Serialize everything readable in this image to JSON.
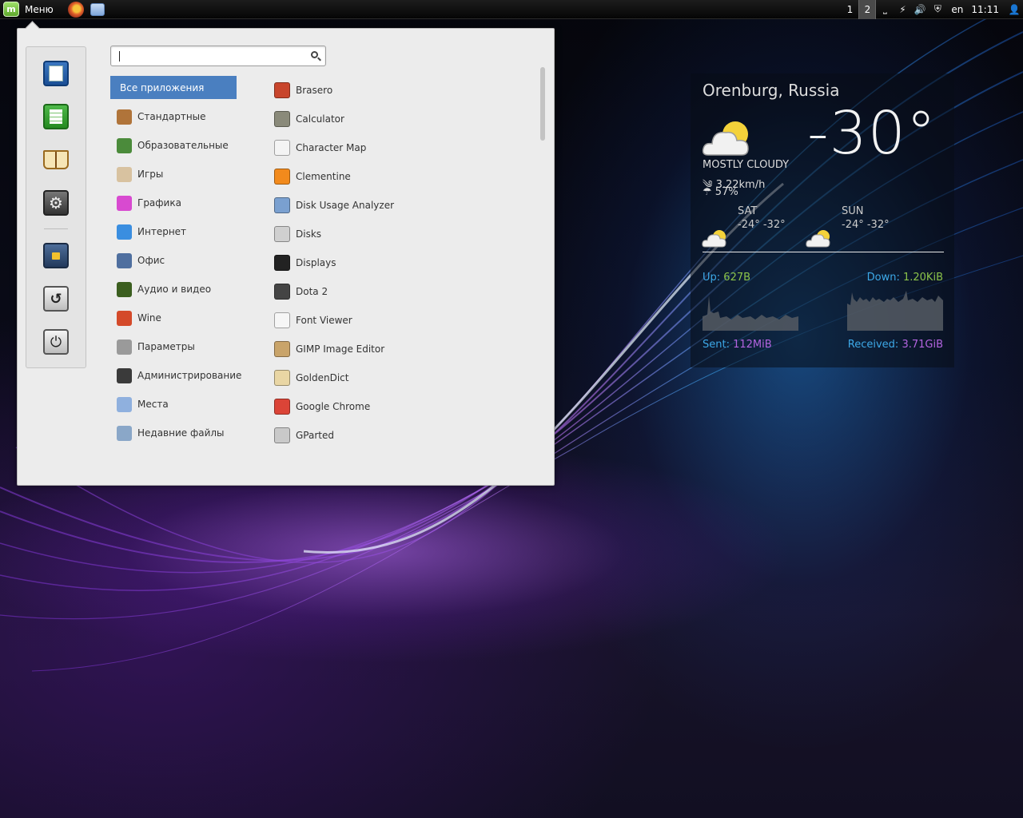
{
  "panel": {
    "menu_label": "Меню",
    "workspaces": [
      "1",
      "2"
    ],
    "active_workspace": "2",
    "keyboard_layout": "en",
    "clock": "11:11",
    "icons": [
      "firefox-icon",
      "files-icon",
      "screen-icon",
      "network-icon",
      "volume-icon",
      "shield-icon",
      "user-icon"
    ]
  },
  "menu": {
    "search": {
      "value": "",
      "placeholder": ""
    },
    "favorites": [
      "writer-icon",
      "calc-icon",
      "dictionary-icon",
      "settings-icon",
      "lock-screen-icon",
      "logout-icon",
      "power-icon"
    ],
    "categories": [
      {
        "label": "Все приложения",
        "icon": "all-apps-icon",
        "color": "#4a7fc0"
      },
      {
        "label": "Стандартные",
        "icon": "accessories-icon",
        "color": "#b0743a"
      },
      {
        "label": "Образовательные",
        "icon": "education-icon",
        "color": "#4b8b3b"
      },
      {
        "label": "Игры",
        "icon": "games-icon",
        "color": "#d8c2a0"
      },
      {
        "label": "Графика",
        "icon": "graphics-icon",
        "color": "#d84ad0"
      },
      {
        "label": "Интернет",
        "icon": "internet-icon",
        "color": "#3a8ee0"
      },
      {
        "label": "Офис",
        "icon": "office-icon",
        "color": "#4f6f9f"
      },
      {
        "label": "Аудио и видео",
        "icon": "multimedia-icon",
        "color": "#3b5e1f"
      },
      {
        "label": "Wine",
        "icon": "wine-icon",
        "color": "#d44a2a"
      },
      {
        "label": "Параметры",
        "icon": "preferences-icon",
        "color": "#9a9a9a"
      },
      {
        "label": "Администрирование",
        "icon": "administration-icon",
        "color": "#3a3a3a"
      },
      {
        "label": "Места",
        "icon": "places-icon",
        "color": "#8fb0de"
      },
      {
        "label": "Недавние файлы",
        "icon": "recent-files-icon",
        "color": "#8aa7c8"
      }
    ],
    "apps": [
      {
        "label": "Brasero",
        "icon": "brasero-icon",
        "color": "#c8452c"
      },
      {
        "label": "Calculator",
        "icon": "calculator-icon",
        "color": "#8a8a7a"
      },
      {
        "label": "Character Map",
        "icon": "character-map-icon",
        "color": "#f4f4f4"
      },
      {
        "label": "Clementine",
        "icon": "clementine-icon",
        "color": "#f28a1c"
      },
      {
        "label": "Disk Usage Analyzer",
        "icon": "disk-usage-icon",
        "color": "#7aa0d0"
      },
      {
        "label": "Disks",
        "icon": "disks-icon",
        "color": "#d0d0d0"
      },
      {
        "label": "Displays",
        "icon": "displays-icon",
        "color": "#222222"
      },
      {
        "label": "Dota 2",
        "icon": "dota2-icon",
        "color": "#444444"
      },
      {
        "label": "Font Viewer",
        "icon": "font-viewer-icon",
        "color": "#f6f6f6"
      },
      {
        "label": "GIMP Image Editor",
        "icon": "gimp-icon",
        "color": "#c9a46a"
      },
      {
        "label": "GoldenDict",
        "icon": "goldendict-icon",
        "color": "#e9d6a4"
      },
      {
        "label": "Google Chrome",
        "icon": "chrome-icon",
        "color": "#db4437"
      },
      {
        "label": "GParted",
        "icon": "gparted-icon",
        "color": "#c9c9c9"
      }
    ]
  },
  "weather": {
    "city": "Orenburg, Russia",
    "temperature": "-30°",
    "condition": "MOSTLY CLOUDY",
    "wind": "3.22km/h",
    "humidity": "57%",
    "forecast": [
      {
        "day": "SAT",
        "range": "-24° -32°"
      },
      {
        "day": "SUN",
        "range": "-24° -32°"
      }
    ]
  },
  "network": {
    "up_label": "Up:",
    "up_value": "627B",
    "down_label": "Down:",
    "down_value": "1.20KiB",
    "sent_label": "Sent:",
    "sent_value": "112MiB",
    "received_label": "Received:",
    "received_value": "3.71GiB",
    "colors": {
      "label": "#3da9e8",
      "rate": "#8bc34a",
      "total": "#b464e0"
    }
  }
}
